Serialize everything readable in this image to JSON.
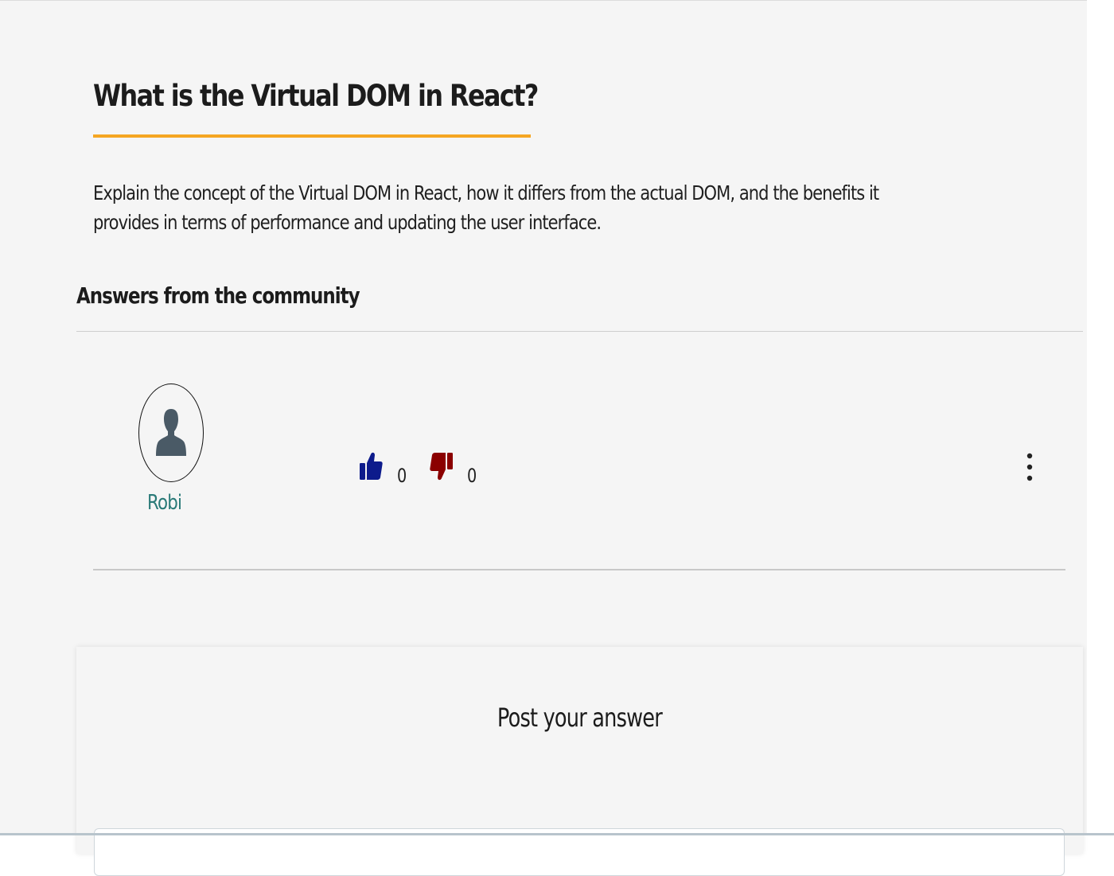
{
  "question": {
    "title": "What is the Virtual DOM in React?",
    "body": "Explain the concept of the Virtual DOM in React, how it differs from the actual DOM, and the benefits it provides in terms of performance and updating the user interface."
  },
  "answers_section": {
    "heading": "Answers from the community"
  },
  "answer": {
    "author": "Robi",
    "avatar_icon": "user-silhouette-icon",
    "upvote_icon": "thumbs-up-icon",
    "upvotes": "0",
    "downvote_icon": "thumbs-down-icon",
    "downvotes": "0",
    "menu_icon": "more-vertical-icon"
  },
  "post_answer": {
    "heading": "Post your answer"
  },
  "colors": {
    "accent": "#f5a623",
    "username": "#2a7a78",
    "upvote": "#0d1b8c",
    "downvote": "#8b0000",
    "avatar": "#4a5a66"
  }
}
